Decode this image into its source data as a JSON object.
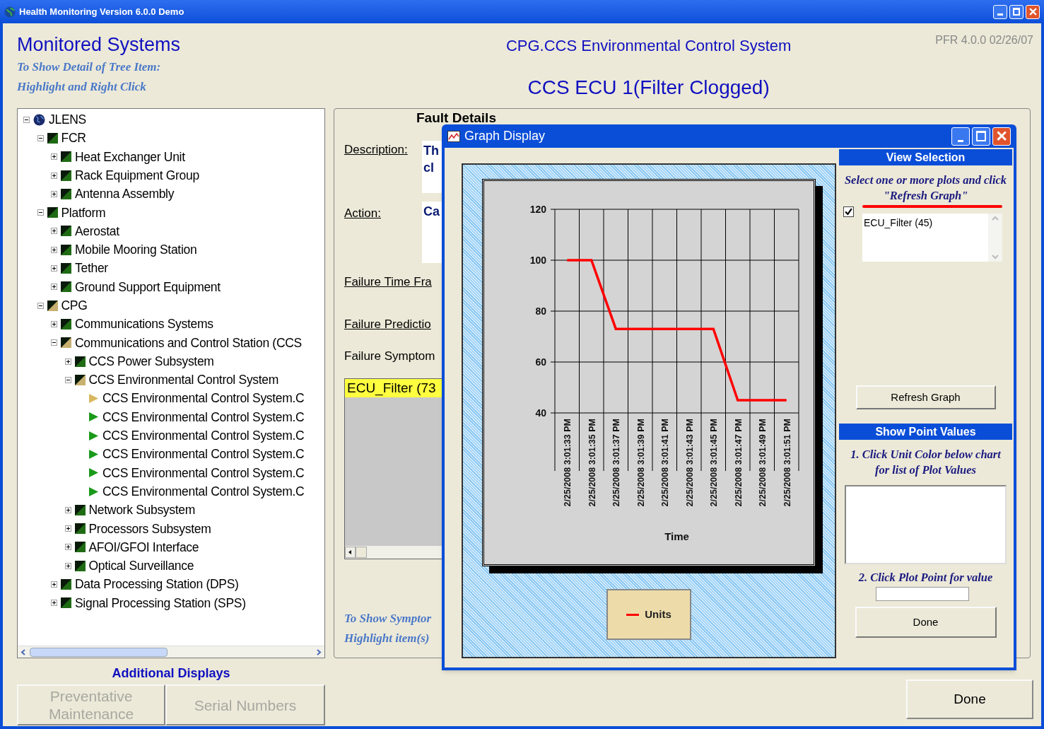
{
  "window": {
    "title": "Health Monitoring Version 6.0.0 Demo"
  },
  "header": {
    "title": "Monitored Systems",
    "hint_lines": [
      "To Show Detail of Tree Item:",
      "Highlight and Right Click"
    ],
    "system": "CPG.CCS Environmental Control System",
    "version": "PFR 4.0.0 02/26/07",
    "fault": "CCS ECU 1(Filter Clogged)"
  },
  "tree": [
    {
      "label": "JLENS",
      "kind": "root",
      "expanded": true,
      "children": [
        {
          "label": "FCR",
          "kind": "system",
          "color": "#1f6b14",
          "expanded": true,
          "children": [
            {
              "label": "Heat Exchanger Unit",
              "kind": "system",
              "color": "#1f6b14",
              "expanded": false
            },
            {
              "label": "Rack Equipment Group",
              "kind": "system",
              "color": "#1f6b14",
              "expanded": false
            },
            {
              "label": "Antenna Assembly",
              "kind": "system",
              "color": "#1f6b14",
              "expanded": false
            }
          ]
        },
        {
          "label": "Platform",
          "kind": "system",
          "color": "#1f6b14",
          "expanded": true,
          "children": [
            {
              "label": "Aerostat",
              "kind": "system",
              "color": "#1f6b14",
              "expanded": false
            },
            {
              "label": "Mobile Mooring Station",
              "kind": "system",
              "color": "#1f6b14",
              "expanded": false
            },
            {
              "label": "Tether",
              "kind": "system",
              "color": "#1f6b14",
              "expanded": false
            },
            {
              "label": "Ground Support Equipment",
              "kind": "system",
              "color": "#1f6b14",
              "expanded": false
            }
          ]
        },
        {
          "label": "CPG",
          "kind": "system",
          "color": "#c8b070",
          "expanded": true,
          "children": [
            {
              "label": "Communications Systems",
              "kind": "system",
              "color": "#1f6b14",
              "expanded": false
            },
            {
              "label": "Communications and Control Station (CCS",
              "kind": "system",
              "color": "#c8b070",
              "expanded": true,
              "children": [
                {
                  "label": "CCS Power Subsystem",
                  "kind": "system",
                  "color": "#1f6b14",
                  "expanded": false
                },
                {
                  "label": "CCS Environmental Control System",
                  "kind": "system",
                  "color": "#c8b070",
                  "expanded": true,
                  "children": [
                    {
                      "label": "CCS Environmental Control System.C",
                      "kind": "parameter",
                      "color": "#d8b860"
                    },
                    {
                      "label": "CCS Environmental Control System.C",
                      "kind": "parameter",
                      "color": "#1a9a1a"
                    },
                    {
                      "label": "CCS Environmental Control System.C",
                      "kind": "parameter",
                      "color": "#1a9a1a"
                    },
                    {
                      "label": "CCS Environmental Control System.C",
                      "kind": "parameter",
                      "color": "#1a9a1a"
                    },
                    {
                      "label": "CCS Environmental Control System.C",
                      "kind": "parameter",
                      "color": "#1a9a1a"
                    },
                    {
                      "label": "CCS Environmental Control System.C",
                      "kind": "parameter",
                      "color": "#1a9a1a"
                    }
                  ]
                },
                {
                  "label": "Network Subsystem",
                  "kind": "system",
                  "color": "#1f6b14",
                  "expanded": false
                },
                {
                  "label": "Processors Subsystem",
                  "kind": "system",
                  "color": "#1f6b14",
                  "expanded": false
                },
                {
                  "label": "AFOI/GFOI Interface",
                  "kind": "system",
                  "color": "#1f6b14",
                  "expanded": false
                },
                {
                  "label": "Optical Surveillance",
                  "kind": "system",
                  "color": "#1f6b14",
                  "expanded": false
                }
              ]
            },
            {
              "label": "Data Processing Station (DPS)",
              "kind": "system",
              "color": "#1f6b14",
              "expanded": false
            },
            {
              "label": "Signal Processing Station (SPS)",
              "kind": "system",
              "color": "#1f6b14",
              "expanded": false
            }
          ]
        }
      ]
    }
  ],
  "fault_details": {
    "title": "Fault Details",
    "description_label": "Description:",
    "description_lines": [
      "Th",
      "cl"
    ],
    "action_label": "Action:",
    "action_text": "Ca",
    "time_frame_label": "Failure Time Fra",
    "prediction_label": "Failure Predictio",
    "symptom_label": "Failure Symptom",
    "symptoms": [
      {
        "label": "ECU_Filter (73",
        "selected": true
      }
    ],
    "hint_lines": [
      "To Show Symptor",
      "Highlight item(s)"
    ]
  },
  "graph_dialog": {
    "title": "Graph Display",
    "chart_data": {
      "type": "line",
      "xlabel": "Time",
      "categories": [
        "2/25/2008 3:01:33 PM",
        "2/25/2008 3:01:35 PM",
        "2/25/2008 3:01:37 PM",
        "2/25/2008 3:01:39 PM",
        "2/25/2008 3:01:41 PM",
        "2/25/2008 3:01:43 PM",
        "2/25/2008 3:01:45 PM",
        "2/25/2008 3:01:47 PM",
        "2/25/2008 3:01:49 PM",
        "2/25/2008 3:01:51 PM"
      ],
      "series": [
        {
          "name": "Units",
          "color": "#ff0000",
          "values": [
            100,
            100,
            73,
            73,
            73,
            73,
            73,
            45,
            45,
            45
          ]
        }
      ],
      "ylim": [
        40,
        120
      ],
      "yticks": [
        40,
        60,
        80,
        100,
        120
      ],
      "grid": true
    },
    "view_selection": {
      "title": "View Selection",
      "hint": "Select one or more plots and click \"Refresh Graph\"",
      "plots": [
        {
          "label": "ECU_Filter (45)",
          "checked": true,
          "color": "#ff0000"
        }
      ],
      "refresh_button": "Refresh Graph"
    },
    "point_values": {
      "title": "Show Point Values",
      "step1": "1. Click Unit Color below chart for list of Plot Values",
      "step2": "2. Click Plot Point for value",
      "done_button": "Done"
    }
  },
  "additional_displays": {
    "title": "Additional Displays",
    "buttons": [
      {
        "label": "Preventative Maintenance",
        "disabled": true
      },
      {
        "label": "Serial Numbers",
        "disabled": true
      }
    ]
  },
  "done_button": "Done"
}
